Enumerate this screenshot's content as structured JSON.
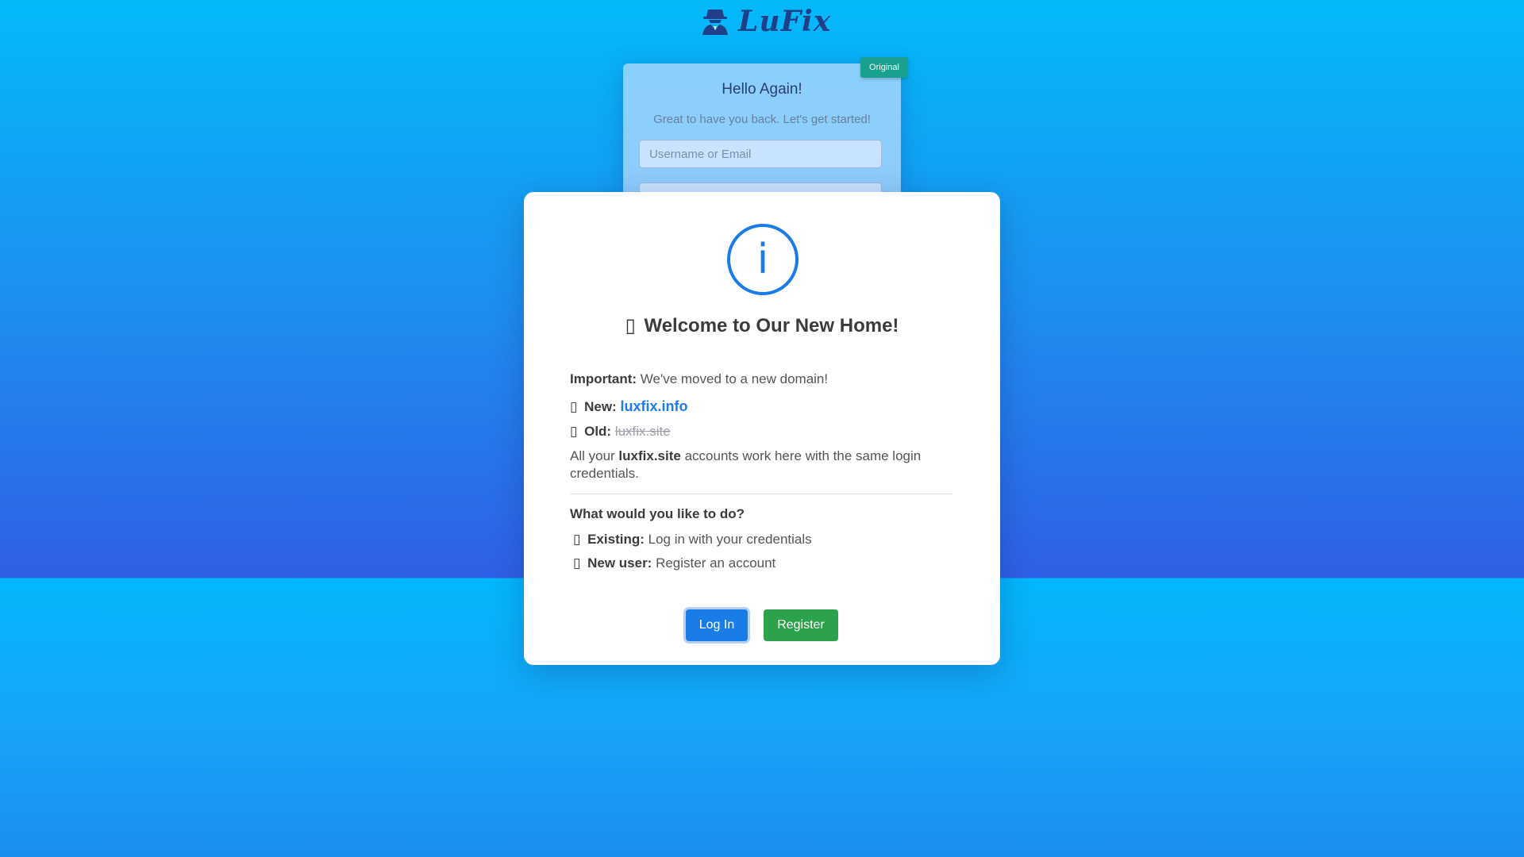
{
  "header": {
    "logo_text": "LuFix",
    "logo_icon": "spy-icon"
  },
  "login_card": {
    "badge": "Original",
    "title": "Hello Again!",
    "subtitle": "Great to have you back. Let's get started!",
    "username_placeholder": "Username or Email"
  },
  "modal": {
    "icon": "info-icon",
    "icon_glyph": "i",
    "title_glyph": "▯",
    "title": "Welcome to Our New Home!",
    "important_label": "Important:",
    "important_text": "We've moved to a new domain!",
    "new_glyph": "▯",
    "new_label": "New:",
    "new_domain": "luxfix.info",
    "old_glyph": "▯",
    "old_label": "Old:",
    "old_domain": "luxfix.site",
    "accounts_pre": "All your",
    "accounts_domain": "luxfix.site",
    "accounts_line1": "accounts work here with the same login",
    "accounts_line2": "credentials.",
    "question": "What would you like to do?",
    "existing_glyph": "▯",
    "existing_label": "Existing:",
    "existing_text": "Log in with your credentials",
    "newuser_glyph": "▯",
    "newuser_label": "New user:",
    "newuser_text": "Register an account",
    "login_button": "Log In",
    "register_button": "Register"
  },
  "colors": {
    "primary": "#1a7ce6",
    "success": "#2ca24a",
    "badge": "#19a08f",
    "background_top": "#03baf9",
    "background_mid": "#2f5fe6"
  }
}
